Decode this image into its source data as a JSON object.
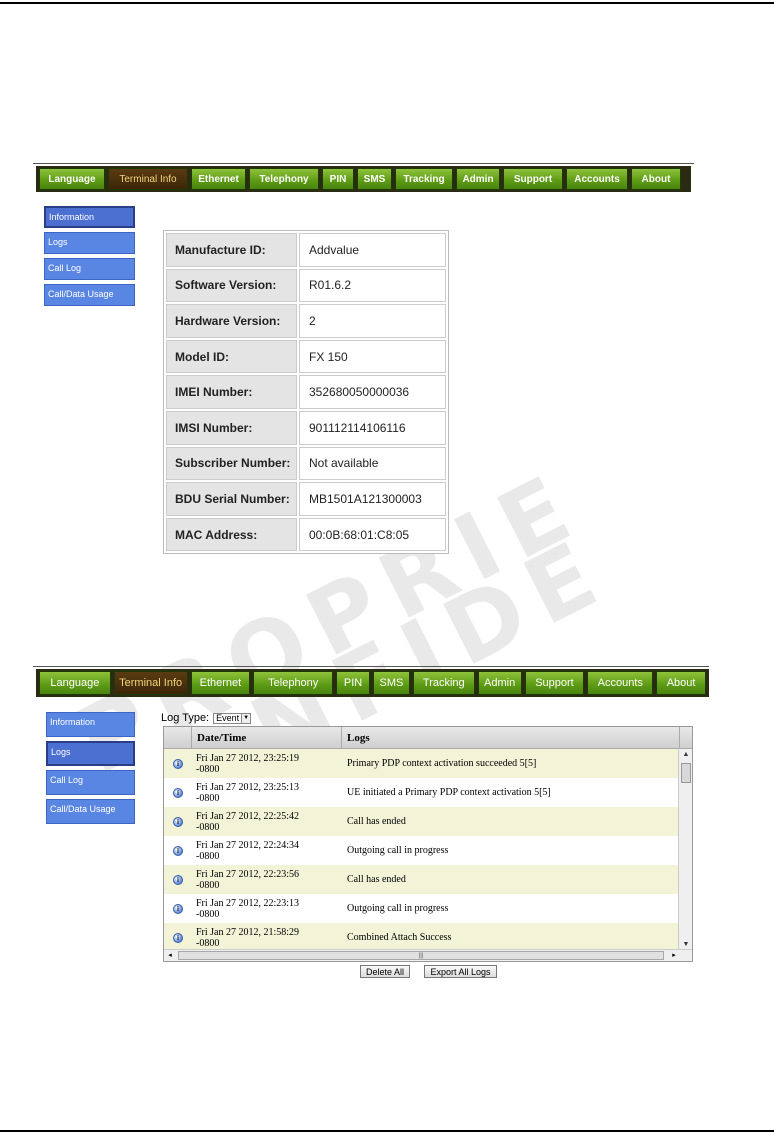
{
  "watermark": {
    "line1": "PROPRIE",
    "line2": "NFIDE"
  },
  "nav1": {
    "tabs": [
      "Language",
      "Terminal Info",
      "Ethernet",
      "Telephony",
      "PIN",
      "SMS",
      "Tracking",
      "Admin",
      "Support",
      "Accounts",
      "About"
    ],
    "active": "Terminal Info"
  },
  "side1": {
    "items": [
      "Information",
      "Logs",
      "Call Log",
      "Call/Data Usage"
    ],
    "active": "Information"
  },
  "info": [
    {
      "label": "Manufacture ID:",
      "value": "Addvalue"
    },
    {
      "label": "Software Version:",
      "value": "R01.6.2"
    },
    {
      "label": "Hardware Version:",
      "value": "2"
    },
    {
      "label": "Model ID:",
      "value": "FX 150"
    },
    {
      "label": "IMEI Number:",
      "value": "352680050000036"
    },
    {
      "label": "IMSI Number:",
      "value": "901112114106116"
    },
    {
      "label": "Subscriber Number:",
      "value": "Not available"
    },
    {
      "label": "BDU Serial Number:",
      "value": "MB1501A121300003"
    },
    {
      "label": "MAC Address:",
      "value": "00:0B:68:01:C8:05"
    }
  ],
  "nav2": {
    "tabs": [
      "Language",
      "Terminal Info",
      "Ethernet",
      "Telephony",
      "PIN",
      "SMS",
      "Tracking",
      "Admin",
      "Support",
      "Accounts",
      "About"
    ],
    "active": "Terminal Info"
  },
  "side2": {
    "items": [
      "Information",
      "Logs",
      "Call Log",
      "Call/Data Usage"
    ],
    "active": "Logs"
  },
  "logs": {
    "type_label": "Log Type:",
    "type_value": "Event",
    "columns": [
      "",
      "Date/Time",
      "Logs"
    ],
    "rows": [
      {
        "date": "Fri Jan 27 2012, 23:25:19",
        "tz": "-0800",
        "log": "Primary PDP context activation succeeded 5[5]"
      },
      {
        "date": "Fri Jan 27 2012, 23:25:13",
        "tz": "-0800",
        "log": "UE initiated a Primary PDP context activation 5[5]"
      },
      {
        "date": "Fri Jan 27 2012, 22:25:42",
        "tz": "-0800",
        "log": "Call has ended"
      },
      {
        "date": "Fri Jan 27 2012, 22:24:34",
        "tz": "-0800",
        "log": "Outgoing call in progress"
      },
      {
        "date": "Fri Jan 27 2012, 22:23:56",
        "tz": "-0800",
        "log": "Call has ended"
      },
      {
        "date": "Fri Jan 27 2012, 22:23:13",
        "tz": "-0800",
        "log": "Outgoing call in progress"
      },
      {
        "date": "Fri Jan 27 2012, 21:58:29",
        "tz": "-0800",
        "log": "Combined Attach Success"
      }
    ],
    "delete_all": "Delete All",
    "export_all": "Export All Logs"
  },
  "icons": {
    "row": "info-icon"
  },
  "colors": {
    "tab_green": "#5c9a14",
    "tab_active": "#3c2608",
    "side_blue": "#5a86e3"
  }
}
